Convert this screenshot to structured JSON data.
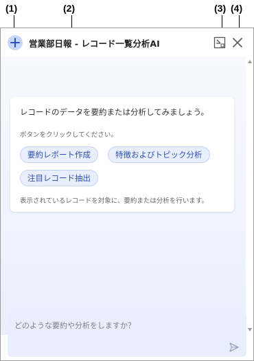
{
  "callouts": [
    "(1)",
    "(2)",
    "(3)",
    "(4)"
  ],
  "header": {
    "title": "営業部日報 - レコード一覧分析AI",
    "new_chat_icon": "plus-icon",
    "minimize_icon": "minimize-window-icon",
    "close_icon": "close-icon"
  },
  "card": {
    "intro": "レコードのデータを要約または分析してみましょう。",
    "hint": "ボタンをクリックしてください。",
    "buttons": [
      "要約レポート作成",
      "特徴およびトピック分析",
      "注目レコード抽出"
    ],
    "footer": "表示されているレコードを対象に、要約または分析を行います。"
  },
  "input": {
    "placeholder": "どのような要約や分析をしますか？",
    "send_icon": "send-icon"
  },
  "colors": {
    "accent": "#2f50b4",
    "chip_bg": "#e8eefc",
    "panel_gradient_top": "#f7f9fe",
    "panel_gradient_bottom": "#e9effd"
  }
}
